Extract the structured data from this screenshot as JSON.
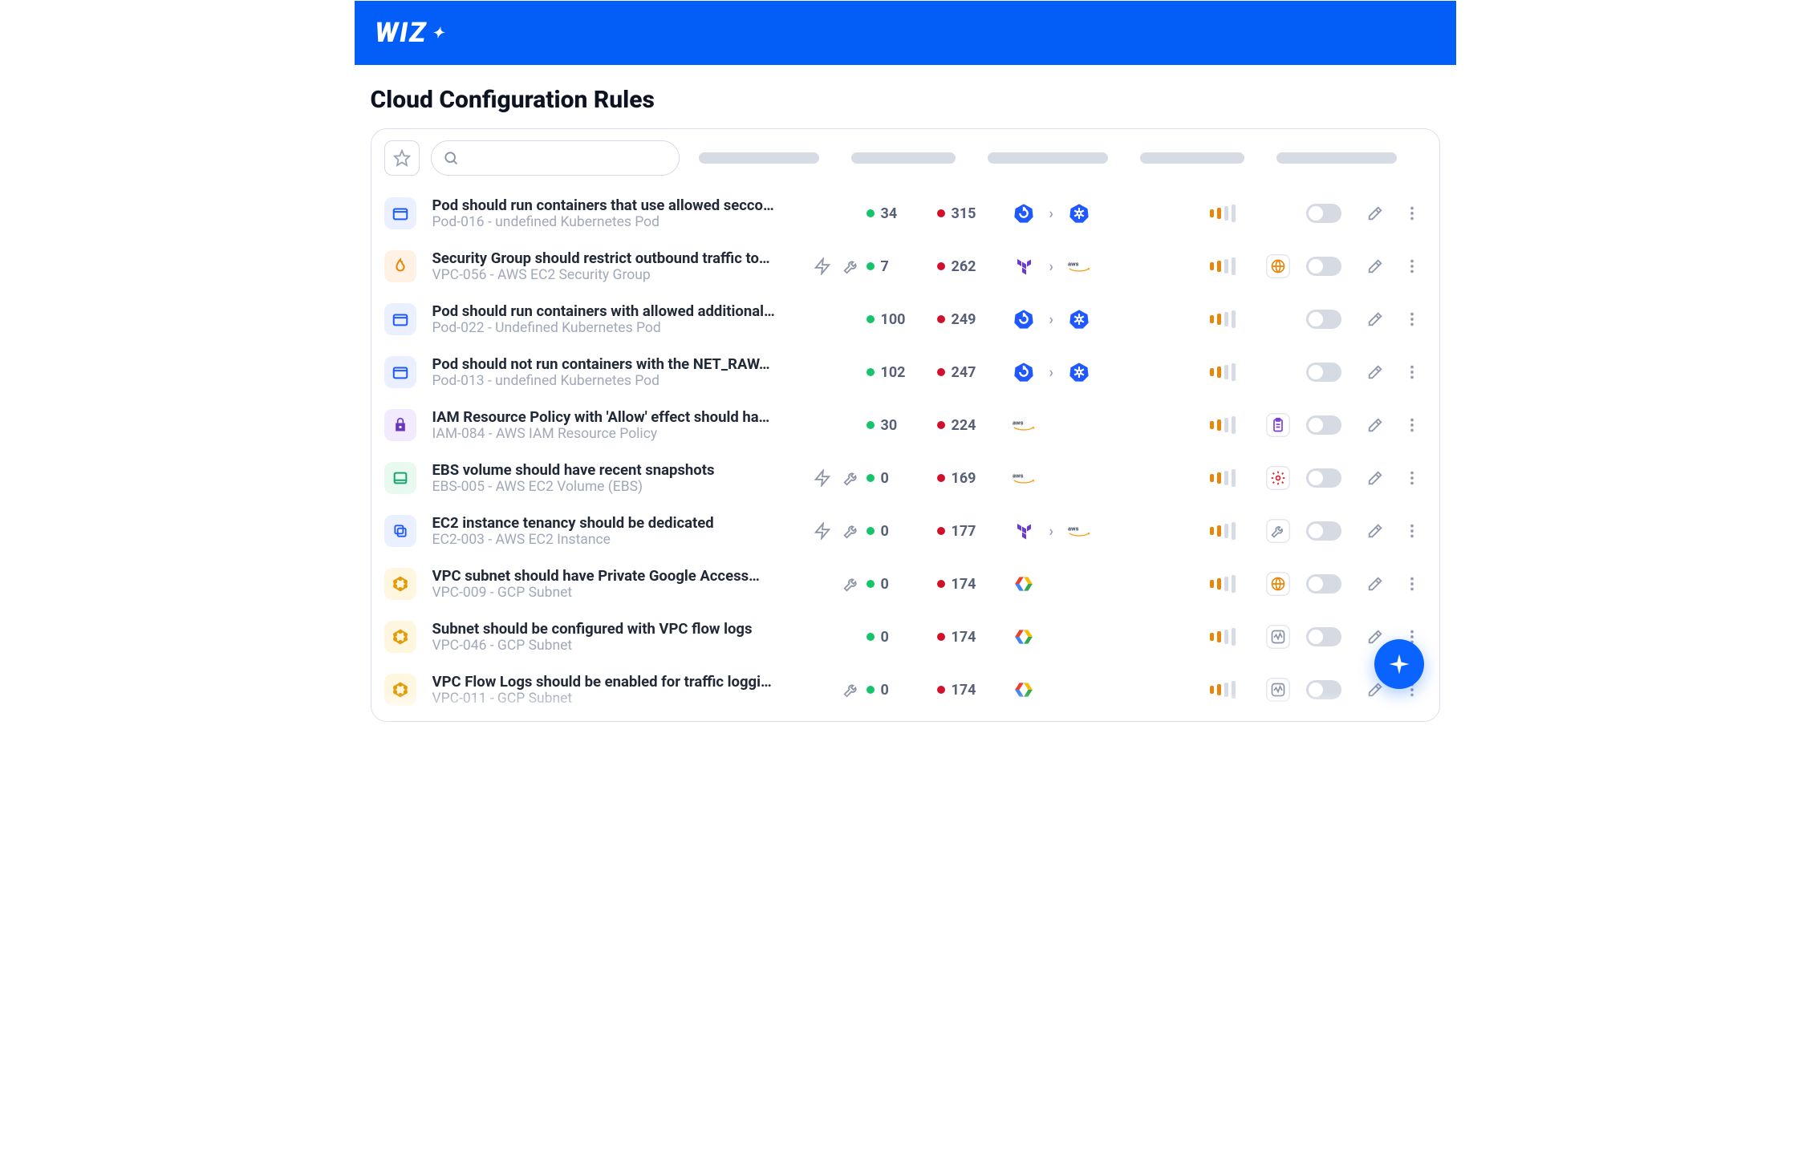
{
  "app": {
    "logo_text": "WIZ"
  },
  "page": {
    "title": "Cloud Configuration Rules"
  },
  "search": {
    "placeholder": ""
  },
  "header_pills": [
    150,
    130,
    150,
    130,
    150
  ],
  "fab_label": "assistant",
  "rules": [
    {
      "icon": "container-icon",
      "icon_bg": "bg-blue-lt",
      "title": "Pod should run containers that use allowed seccom…",
      "subtitle": "Pod-016 - undefined Kubernetes Pod",
      "zap": false,
      "wrench": false,
      "pass": "34",
      "fail": "315",
      "providers": [
        "kube-restart-icon",
        "chevron",
        "kube-icon"
      ],
      "sev": "med",
      "category": "",
      "toggled": false
    },
    {
      "icon": "fire-icon",
      "icon_bg": "bg-orange-lt",
      "title": "Security Group should restrict outbound traffic to…",
      "subtitle": "VPC-056 - AWS EC2 Security Group",
      "zap": true,
      "wrench": true,
      "pass": "7",
      "fail": "262",
      "providers": [
        "terraform-icon",
        "chevron",
        "aws-icon"
      ],
      "sev": "med",
      "category": "globe",
      "toggled": false
    },
    {
      "icon": "container-icon",
      "icon_bg": "bg-blue-lt",
      "title": "Pod should run containers with allowed additional…",
      "subtitle": "Pod-022 - Undefined Kubernetes Pod",
      "zap": false,
      "wrench": false,
      "pass": "100",
      "fail": "249",
      "providers": [
        "kube-restart-icon",
        "chevron",
        "kube-icon"
      ],
      "sev": "med",
      "category": "",
      "toggled": false
    },
    {
      "icon": "container-icon",
      "icon_bg": "bg-blue-lt",
      "title": "Pod should not run containers with the NET_RAW…",
      "subtitle": "Pod-013 - undefined Kubernetes Pod",
      "zap": false,
      "wrench": false,
      "pass": "102",
      "fail": "247",
      "providers": [
        "kube-restart-icon",
        "chevron",
        "kube-icon"
      ],
      "sev": "med",
      "category": "",
      "toggled": false
    },
    {
      "icon": "iam-icon",
      "icon_bg": "bg-purple-lt",
      "title": "IAM Resource Policy with 'Allow' effect should have…",
      "subtitle": "IAM-084 - AWS IAM Resource Policy",
      "zap": false,
      "wrench": false,
      "pass": "30",
      "fail": "224",
      "providers": [
        "aws-icon"
      ],
      "sev": "med",
      "category": "clipboard",
      "toggled": false
    },
    {
      "icon": "disk-icon",
      "icon_bg": "bg-green-lt",
      "title": "EBS volume should have recent snapshots",
      "subtitle": "EBS-005 - AWS EC2 Volume (EBS)",
      "zap": true,
      "wrench": true,
      "pass": "0",
      "fail": "169",
      "providers": [
        "aws-icon"
      ],
      "sev": "med",
      "category": "gear",
      "toggled": false
    },
    {
      "icon": "copy-icon",
      "icon_bg": "bg-blue-lt",
      "title": "EC2 instance tenancy should be dedicated",
      "subtitle": "EC2-003 - AWS EC2 Instance",
      "zap": true,
      "wrench": true,
      "pass": "0",
      "fail": "177",
      "providers": [
        "terraform-icon",
        "chevron",
        "aws-icon"
      ],
      "sev": "med",
      "category": "wrench",
      "toggled": false
    },
    {
      "icon": "net-icon",
      "icon_bg": "bg-gold-lt",
      "title": "VPC subnet should have Private Google Access…",
      "subtitle": "VPC-009 - GCP Subnet",
      "zap": false,
      "wrench": true,
      "pass": "0",
      "fail": "174",
      "providers": [
        "gcp-icon"
      ],
      "sev": "med",
      "category": "globe",
      "toggled": false
    },
    {
      "icon": "net-icon",
      "icon_bg": "bg-gold-lt",
      "title": "Subnet should be configured with VPC flow logs",
      "subtitle": "VPC-046 - GCP Subnet",
      "zap": false,
      "wrench": false,
      "pass": "0",
      "fail": "174",
      "providers": [
        "gcp-icon"
      ],
      "sev": "med",
      "category": "activity",
      "toggled": false
    },
    {
      "icon": "net-icon",
      "icon_bg": "bg-gold-lt",
      "title": "VPC Flow Logs should be enabled for traffic logging",
      "subtitle": "VPC-011 - GCP Subnet",
      "zap": false,
      "wrench": true,
      "pass": "0",
      "fail": "174",
      "providers": [
        "gcp-icon"
      ],
      "sev": "med",
      "category": "activity",
      "toggled": false
    }
  ]
}
